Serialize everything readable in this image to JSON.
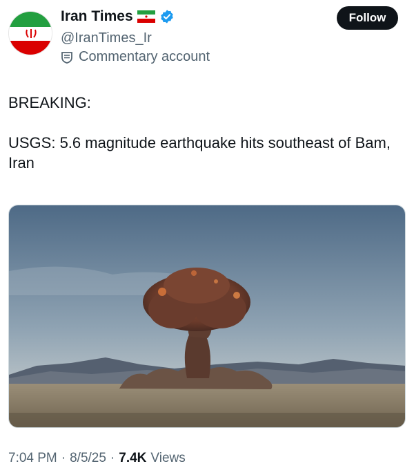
{
  "author": {
    "display_name": "Iran Times",
    "handle": "@IranTimes_Ir",
    "account_label": "Commentary account",
    "flag_icon": "iran-flag-icon",
    "verified_icon": "verified-badge-icon",
    "label_icon": "commentary-icon"
  },
  "actions": {
    "follow_label": "Follow"
  },
  "tweet": {
    "lines": [
      "BREAKING:",
      "USGS: 5.6 magnitude earthquake hits southeast of Bam, Iran"
    ]
  },
  "media": {
    "description_icon": "mushroom-cloud-image"
  },
  "meta": {
    "time": "7:04 PM",
    "date": "8/5/25",
    "views_count": "7.4K",
    "views_label": "Views",
    "separator": "·"
  },
  "colors": {
    "text": "#0f1419",
    "muted": "#536471",
    "verified": "#1d9bf0",
    "button_bg": "#0f1419"
  }
}
